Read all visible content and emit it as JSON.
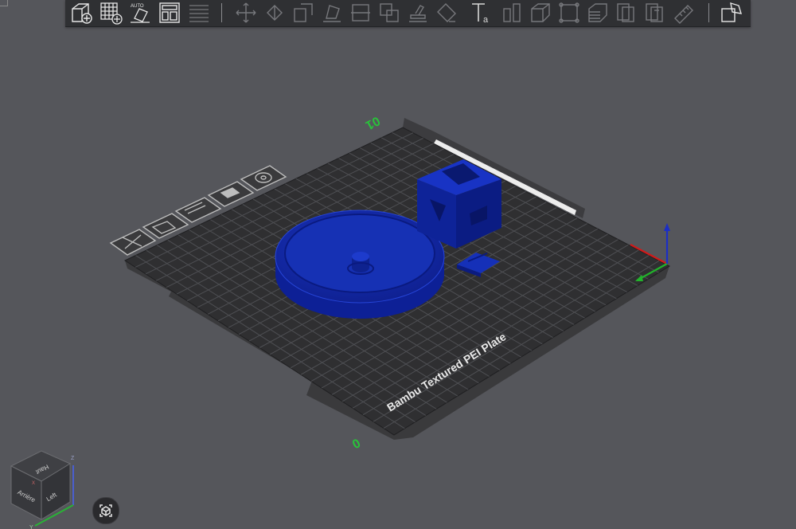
{
  "toolbar": {
    "buttons": [
      {
        "name": "add-object-icon",
        "label": ""
      },
      {
        "name": "add-plate-icon",
        "label": ""
      },
      {
        "name": "auto-orient-icon",
        "label": "AUTO"
      },
      {
        "name": "arrange-icon",
        "label": ""
      },
      {
        "name": "split-plates-icon",
        "label": ""
      },
      {
        "name": "move-icon",
        "label": ""
      },
      {
        "name": "rotate-icon",
        "label": ""
      },
      {
        "name": "scale-icon",
        "label": ""
      },
      {
        "name": "lay-on-face-icon",
        "label": ""
      },
      {
        "name": "cut-icon",
        "label": ""
      },
      {
        "name": "boolean-icon",
        "label": ""
      },
      {
        "name": "support-paint-icon",
        "label": ""
      },
      {
        "name": "seam-paint-icon",
        "label": ""
      },
      {
        "name": "text-tool-icon",
        "label": "a"
      },
      {
        "name": "measure-icon",
        "label": ""
      },
      {
        "name": "assembly-icon",
        "label": ""
      },
      {
        "name": "variable-layer-icon",
        "label": ""
      },
      {
        "name": "brim-ears-icon",
        "label": ""
      },
      {
        "name": "multi-color-icon",
        "label": ""
      },
      {
        "name": "slice-plate-icon",
        "label": ""
      },
      {
        "name": "ruler-icon",
        "label": ""
      },
      {
        "name": "assembly-view-icon",
        "label": ""
      }
    ]
  },
  "plate": {
    "name": "Bambu Textured PEI Plate",
    "number_top": "01",
    "number_bottom": "0",
    "tools": [
      "delete-plate-icon",
      "arrange-plate-icon",
      "plate-layout-icon",
      "plate-color-icon",
      "plate-settings-icon"
    ]
  },
  "view_cube": {
    "top_label": "Haut",
    "left_label": "Left",
    "back_label": "Arrière",
    "x_label": "X",
    "y_label": "Y",
    "z_label": "Z"
  },
  "colors": {
    "background": "#55565b",
    "bed": "#2f2f31",
    "grid": "#505155",
    "model": "#1027a8",
    "axis_x": "#d21a1a",
    "axis_y": "#22b22b",
    "axis_z": "#1b2ec6",
    "plate_number": "#29c23a"
  }
}
